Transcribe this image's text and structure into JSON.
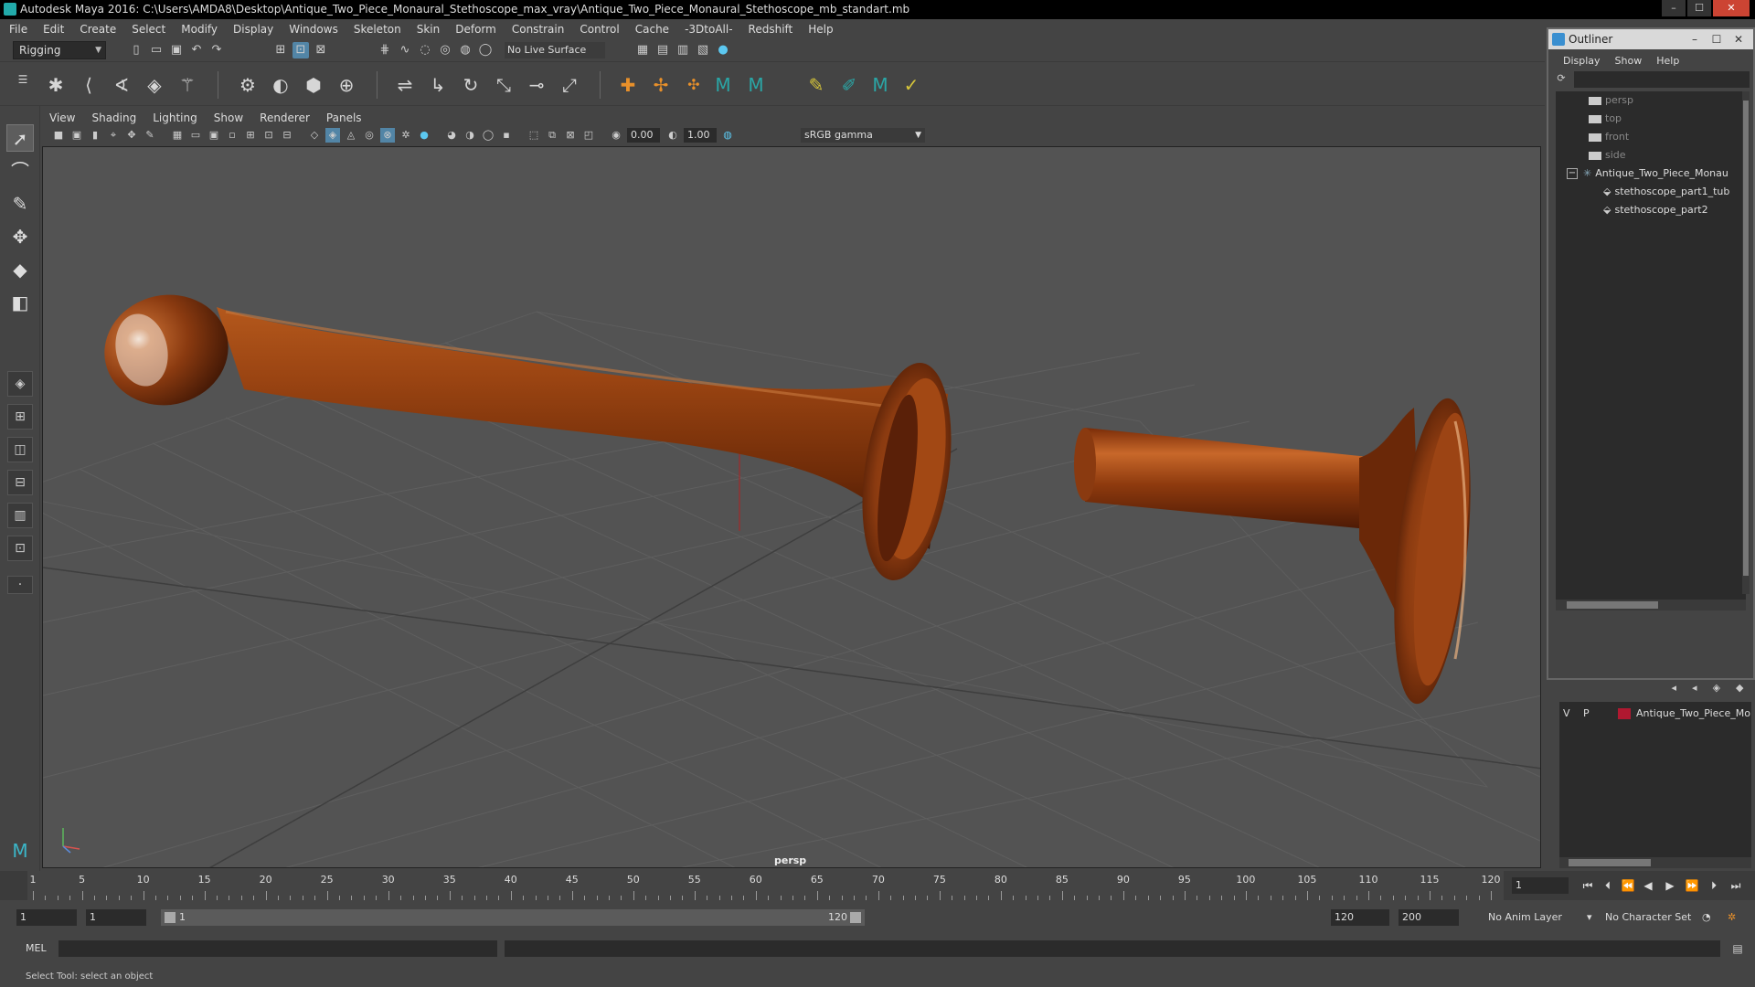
{
  "window": {
    "title": "Autodesk Maya 2016: C:\\Users\\AMDA8\\Desktop\\Antique_Two_Piece_Monaural_Stethoscope_max_vray\\Antique_Two_Piece_Monaural_Stethoscope_mb_standart.mb",
    "minimize": "–",
    "maximize": "☐",
    "close": "✕"
  },
  "menubar": [
    "File",
    "Edit",
    "Create",
    "Select",
    "Modify",
    "Display",
    "Windows",
    "Skeleton",
    "Skin",
    "Deform",
    "Constrain",
    "Control",
    "Cache",
    "-3DtoAll-",
    "Redshift",
    "Help"
  ],
  "statusline": {
    "mode": "Rigging",
    "live_surface": "No Live Surface"
  },
  "panel": {
    "menu": [
      "View",
      "Shading",
      "Lighting",
      "Show",
      "Renderer",
      "Panels"
    ],
    "exposure": "0.00",
    "gamma": "1.00",
    "color_space": "sRGB gamma",
    "camera": "persp"
  },
  "timeline": {
    "ticks": [
      1,
      5,
      10,
      15,
      20,
      25,
      30,
      35,
      40,
      45,
      50,
      55,
      60,
      65,
      70,
      75,
      80,
      85,
      90,
      95,
      100,
      105,
      110,
      115,
      120
    ],
    "current_frame": "1"
  },
  "range": {
    "start": "1",
    "playback_start": "1",
    "bar_start": "1",
    "bar_end": "120",
    "playback_end": "120",
    "end": "200",
    "anim_layer": "No Anim Layer",
    "character_set": "No Character Set"
  },
  "command": {
    "label": "MEL",
    "help": "Select Tool: select an object"
  },
  "outliner": {
    "title": "Outliner",
    "menu": [
      "Display",
      "Show",
      "Help"
    ],
    "items": [
      {
        "label": "persp",
        "type": "camera"
      },
      {
        "label": "top",
        "type": "camera"
      },
      {
        "label": "front",
        "type": "camera"
      },
      {
        "label": "side",
        "type": "camera"
      },
      {
        "label": "Antique_Two_Piece_Monau",
        "type": "group"
      },
      {
        "label": "stethoscope_part1_tub",
        "type": "mesh"
      },
      {
        "label": "stethoscope_part2",
        "type": "mesh"
      }
    ]
  },
  "layers": {
    "v": "V",
    "p": "P",
    "name": "Antique_Two_Piece_Mo",
    "color": "#b01830"
  },
  "colors": {
    "accent": "#5285a6",
    "wood": "#8a3a10"
  }
}
